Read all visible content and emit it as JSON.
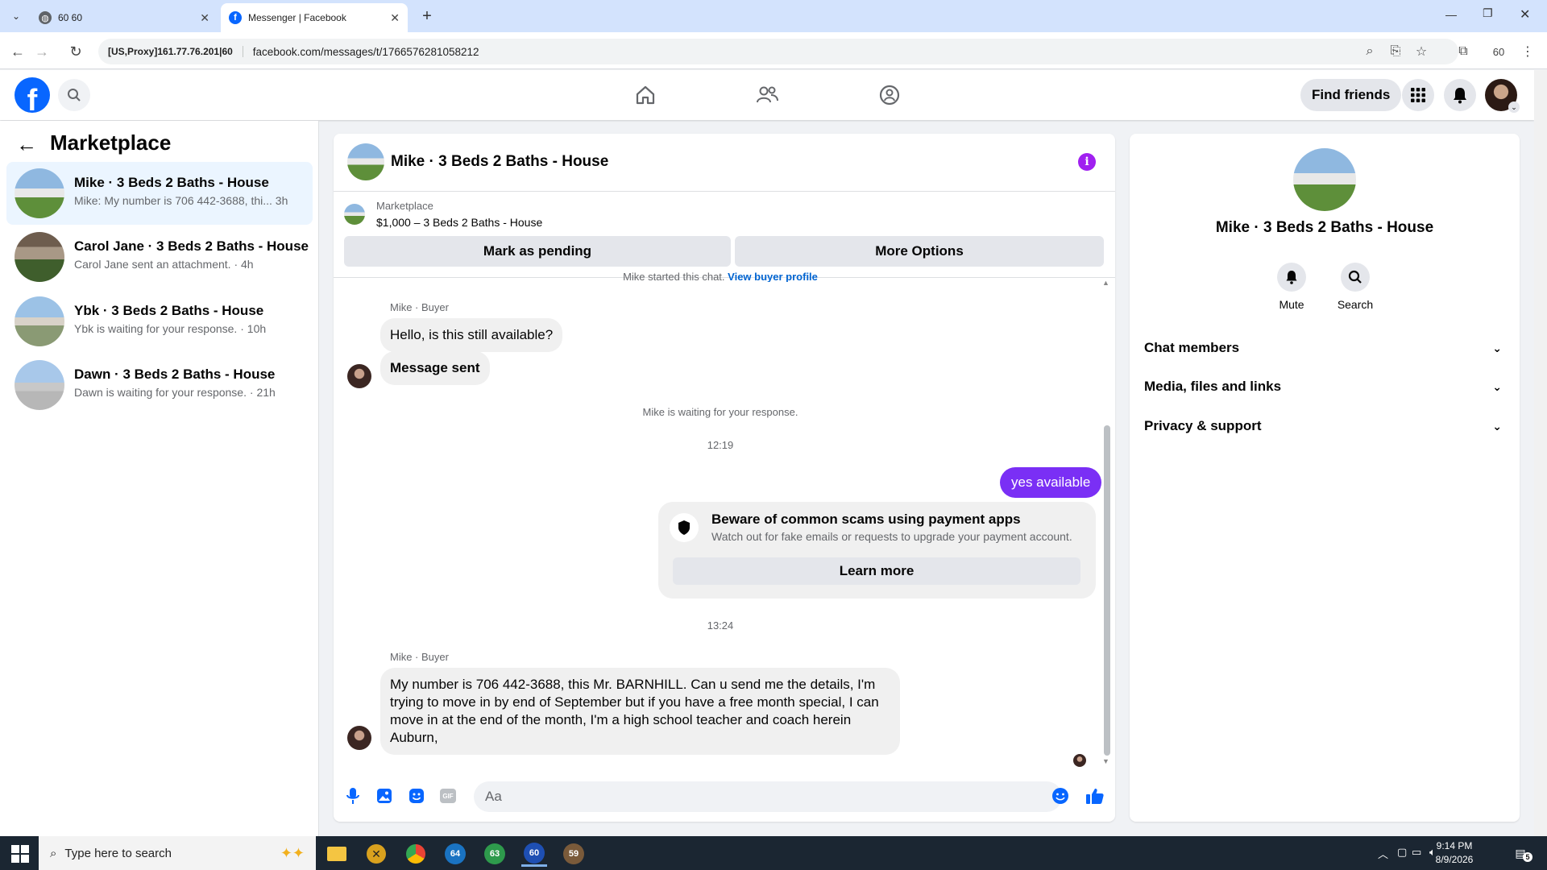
{
  "browser": {
    "tabs": [
      {
        "label": "60 60",
        "active": false
      },
      {
        "label": "Messenger | Facebook",
        "active": true
      }
    ],
    "new_tab_label": "+",
    "proxy_chip": "[US,Proxy]161.77.76.201|60",
    "url": "facebook.com/messages/t/1766576281058212",
    "profile_badge": "60"
  },
  "header": {
    "find_friends_label": "Find friends"
  },
  "left": {
    "title": "Marketplace",
    "conversations": [
      {
        "name": "Mike · 3 Beds 2 Baths - House",
        "preview": "Mike: My number is 706 442-3688, thi...",
        "time": "3h"
      },
      {
        "name": "Carol Jane · 3 Beds 2 Baths - House",
        "preview": "Carol Jane sent an attachment.",
        "time": "4h"
      },
      {
        "name": "Ybk · 3 Beds 2 Baths - House",
        "preview": "Ybk is waiting for your response.",
        "time": "10h"
      },
      {
        "name": "Dawn · 3 Beds 2 Baths - House",
        "preview": "Dawn is waiting for your response.",
        "time": "21h"
      }
    ]
  },
  "chat": {
    "title": "Mike · 3 Beds 2 Baths - House",
    "marketplace_label": "Marketplace",
    "listing": "$1,000 – 3 Beds 2 Baths - House",
    "mark_pending_label": "Mark as pending",
    "more_options_label": "More Options",
    "started_text": "Mike started this chat.",
    "view_profile_link": "View buyer profile",
    "sender_label_1": "Mike · Buyer",
    "msg_1": "Hello, is this still available?",
    "msg_2": "Message sent",
    "waiting": "Mike is waiting for your response.",
    "time_1": "12:19",
    "my_msg": "yes available",
    "scam_title": "Beware of common scams using payment apps",
    "scam_sub": "Watch out for fake emails or requests to upgrade your payment account.",
    "learn_more_label": "Learn more",
    "time_2": "13:24",
    "sender_label_2": "Mike · Buyer",
    "msg_3": "My number is 706 442-3688,  this Mr. BARNHILL. Can u send me the details,  I'm trying to move in by end of September  but if you have a free month special,  I can move in at the end of the month,  I'm a high school teacher and coach herein Auburn,",
    "composer_placeholder": "Aa"
  },
  "right": {
    "name": "Mike · 3 Beds 2 Baths - House",
    "mute_label": "Mute",
    "search_label": "Search",
    "sections": [
      "Chat members",
      "Media, files and links",
      "Privacy & support"
    ]
  },
  "taskbar": {
    "search_placeholder": "Type here to search",
    "time": "9:14 PM",
    "date": "8/9/2026",
    "notif_count": "5",
    "apps": [
      "64",
      "63",
      "60",
      "59"
    ]
  },
  "colors": {
    "fb_blue": "#0866ff",
    "messenger_purple": "#7a2ff5",
    "info_purple": "#a020f0"
  }
}
